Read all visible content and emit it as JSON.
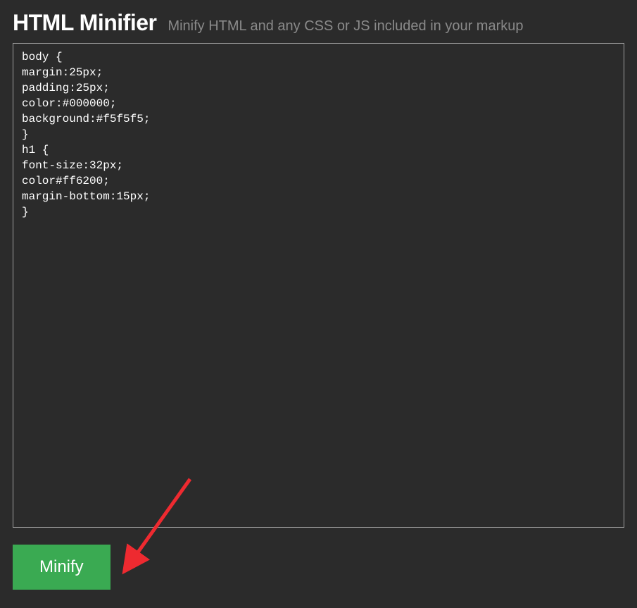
{
  "header": {
    "title": "HTML Minifier",
    "subtitle": "Minify HTML and any CSS or JS included in your markup"
  },
  "editor": {
    "content": "body {\nmargin:25px;\npadding:25px;\ncolor:#000000;\nbackground:#f5f5f5;\n}\nh1 {\nfont-size:32px;\ncolor#ff6200;\nmargin-bottom:15px;\n}"
  },
  "actions": {
    "minify_label": "Minify"
  },
  "annotation": {
    "arrow_color": "#ee2a30"
  }
}
